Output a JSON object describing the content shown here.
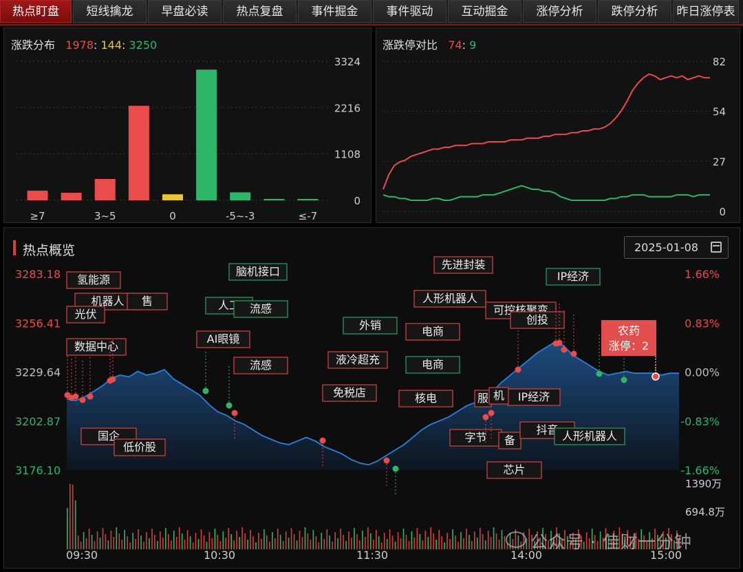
{
  "tabs": [
    "热点盯盘",
    "短线擒龙",
    "早盘必读",
    "热点复盘",
    "事件掘金",
    "事件驱动",
    "互动掘金",
    "涨停分析",
    "跌停分析",
    "昨日涨停表"
  ],
  "active_tab": 0,
  "dist_panel": {
    "title": "涨跌分布",
    "up": "1978",
    "flat": "144",
    "down": "3250",
    "sep": ":"
  },
  "limit_panel": {
    "title": "涨跌停对比",
    "up": "74",
    "down": "9",
    "sep": ":"
  },
  "overview": {
    "title": "热点概览",
    "date": "2025-01-08",
    "watermark": "公众号 · 佳财一分钟",
    "callout_title": "农药",
    "callout_sub": "涨停：2"
  },
  "colors": {
    "up": "#e84c4c",
    "down": "#2fb56a",
    "flat": "#e8c636",
    "accent": "#9e1010",
    "line": "#2f7fd8"
  },
  "chart_data": [
    {
      "type": "bar",
      "title": "涨跌分布",
      "categories": [
        "≥7",
        "",
        "3~5",
        "",
        "0",
        "",
        "-5~-3",
        "",
        "≤-7"
      ],
      "values": [
        230,
        180,
        510,
        2260,
        144,
        3124,
        190,
        25,
        25
      ],
      "colors": [
        "#e84c4c",
        "#e84c4c",
        "#e84c4c",
        "#e84c4c",
        "#e8c636",
        "#2fb56a",
        "#2fb56a",
        "#2fb56a",
        "#2fb56a"
      ],
      "yticks": [
        "3324",
        "2216",
        "1108",
        "0"
      ],
      "ylim": [
        0,
        3324
      ],
      "grid": true
    },
    {
      "type": "line",
      "title": "涨跌停对比",
      "yticks": [
        "82",
        "54",
        "27",
        "0"
      ],
      "ylim": [
        0,
        82
      ],
      "series": [
        {
          "color": "#e84c4c",
          "values": [
            12,
            20,
            25,
            27,
            28,
            30,
            31,
            32,
            33,
            34,
            34,
            35,
            35,
            36,
            36,
            36,
            37,
            37,
            37,
            38,
            38,
            38,
            38,
            39,
            39,
            39,
            40,
            40,
            40,
            41,
            41,
            42,
            42,
            42,
            43,
            43,
            44,
            44,
            45,
            45,
            46,
            48,
            51,
            55,
            60,
            66,
            70,
            73,
            75,
            74,
            72,
            73,
            74,
            73,
            74,
            72,
            73,
            74,
            73,
            73
          ]
        },
        {
          "color": "#2fb56a",
          "values": [
            9,
            8,
            8,
            7,
            7,
            6,
            6,
            6,
            6,
            7,
            7,
            6,
            6,
            7,
            8,
            8,
            8,
            8,
            9,
            9,
            9,
            10,
            11,
            12,
            13,
            14,
            13,
            12,
            12,
            11,
            11,
            10,
            8,
            7,
            6,
            6,
            6,
            6,
            6,
            6,
            6,
            7,
            7,
            8,
            8,
            9,
            9,
            9,
            8,
            8,
            8,
            8,
            8,
            9,
            9,
            9,
            8,
            9,
            9,
            9
          ]
        }
      ]
    },
    {
      "type": "area",
      "title": "热点概览",
      "xticks": [
        "09:30",
        "10:30",
        "11:30",
        "14:00",
        "15:00"
      ],
      "yticks_left": [
        "3283.18",
        "3256.41",
        "3229.64",
        "3202.87",
        "3176.10"
      ],
      "yticks_right": [
        "1.66%",
        "0.83%",
        "0.00%",
        "-0.83%",
        "-1.66%"
      ],
      "volume_ticks": [
        "1390万",
        "694.8万"
      ],
      "ylim": [
        3176.1,
        3283.18
      ],
      "values": [
        3215,
        3214,
        3216,
        3219,
        3222,
        3226,
        3228,
        3227,
        3230,
        3228,
        3229,
        3231,
        3226,
        3223,
        3220,
        3217,
        3212,
        3208,
        3206,
        3203,
        3201,
        3198,
        3195,
        3193,
        3191,
        3190,
        3192,
        3194,
        3192,
        3189,
        3187,
        3185,
        3182,
        3180,
        3179,
        3181,
        3184,
        3187,
        3190,
        3194,
        3198,
        3201,
        3203,
        3205,
        3208,
        3211,
        3213,
        3216,
        3219,
        3224,
        3228,
        3232,
        3236,
        3240,
        3243,
        3246,
        3244,
        3239,
        3236,
        3233,
        3230,
        3228,
        3229,
        3230,
        3229,
        3229,
        3229,
        3228,
        3229,
        3229
      ]
    }
  ],
  "tags": [
    {
      "text": "氢能源",
      "border": "#d64545"
    },
    {
      "text": "机器人",
      "border": "#d64545"
    },
    {
      "text": "售",
      "border": "#d64545"
    },
    {
      "text": "光伏",
      "border": "#d64545"
    },
    {
      "text": "数据中心",
      "border": "#d64545"
    },
    {
      "text": "国企",
      "border": "#d64545"
    },
    {
      "text": "低价股",
      "border": "#d64545"
    },
    {
      "text": "脑机接口",
      "border": "#2fa060"
    },
    {
      "text": "人工",
      "border": "#2fa060"
    },
    {
      "text": "流感",
      "border": "#2fa060"
    },
    {
      "text": "AI眼镜",
      "border": "#d64545"
    },
    {
      "text": "流感",
      "border": "#d64545"
    },
    {
      "text": "外销",
      "border": "#2fa060"
    },
    {
      "text": "液冷超充",
      "border": "#d64545"
    },
    {
      "text": "免税店",
      "border": "#d64545"
    },
    {
      "text": "电商",
      "border": "#d64545"
    },
    {
      "text": "电商",
      "border": "#2fa060"
    },
    {
      "text": "核电",
      "border": "#d64545"
    },
    {
      "text": "先进封装",
      "border": "#d64545"
    },
    {
      "text": "人形机器人",
      "border": "#d64545"
    },
    {
      "text": "可控核聚变",
      "border": "#d64545"
    },
    {
      "text": "创投",
      "border": "#d64545"
    },
    {
      "text": "IP经济",
      "border": "#2fa060"
    },
    {
      "text": "IP经济",
      "border": "#d64545"
    },
    {
      "text": "服",
      "border": "#d64545"
    },
    {
      "text": "机",
      "border": "#d64545"
    },
    {
      "text": "字节",
      "border": "#d64545"
    },
    {
      "text": "备",
      "border": "#d64545"
    },
    {
      "text": "抖音",
      "border": "#d64545"
    },
    {
      "text": "人形机器人",
      "border": "#2fa060"
    },
    {
      "text": "芯片",
      "border": "#d64545"
    }
  ]
}
